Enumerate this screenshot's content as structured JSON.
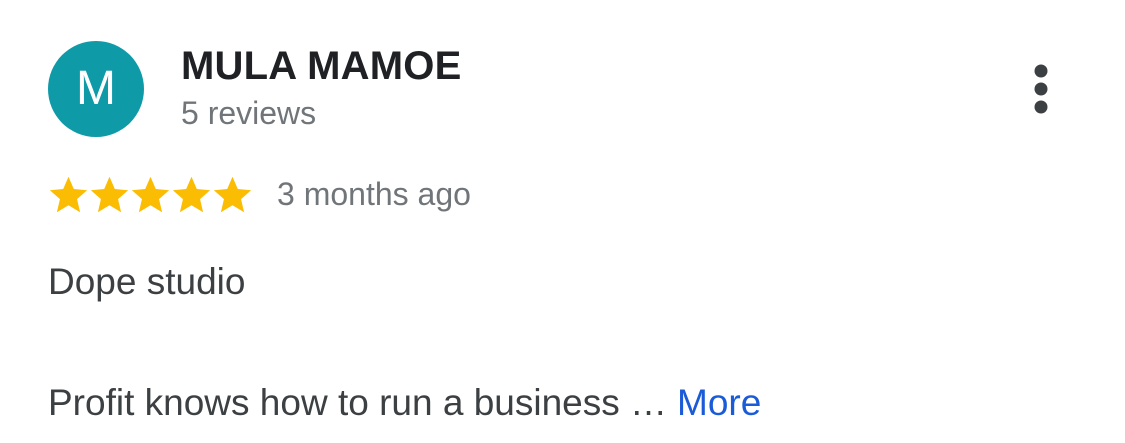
{
  "review": {
    "avatar_initial": "M",
    "avatar_color": "#0f9aa8",
    "author_name": "MULA MAMOE",
    "review_count": "5 reviews",
    "rating": 5,
    "rating_max": 5,
    "star_color": "#fbbc04",
    "date": "3 months ago",
    "text_line_1": "Dope studio",
    "text_line_2": "Profit knows how to run a business …",
    "more_label": "More",
    "link_color": "#1a5bd8",
    "menu_icon": "more-vert-icon"
  }
}
